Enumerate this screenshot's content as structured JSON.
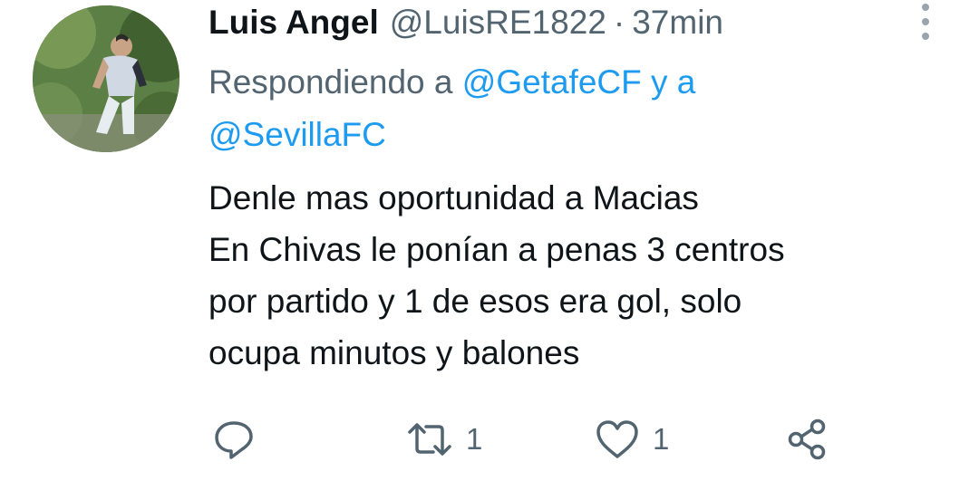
{
  "tweet": {
    "display_name": "Luis Angel",
    "handle": "@LuisRE1822",
    "separator": "·",
    "time": "37min",
    "reply_prefix": "Respondiendo a",
    "reply_mention_1": "@GetafeCF",
    "reply_conjunction": "y a",
    "reply_mention_2": "@SevillaFC",
    "body_lines": [
      "Denle mas oportunidad a Macias",
      "En Chivas le ponían a penas 3 centros",
      "por partido y 1 de esos era gol, solo",
      "ocupa minutos y balones"
    ],
    "retweet_count": "1",
    "like_count": "1"
  },
  "icons": [
    "more-vertical-icon",
    "reply-icon",
    "retweet-icon",
    "like-icon",
    "share-icon"
  ],
  "colors": {
    "text": "#0f1419",
    "secondary": "#536471",
    "link": "#1d9bf0"
  }
}
